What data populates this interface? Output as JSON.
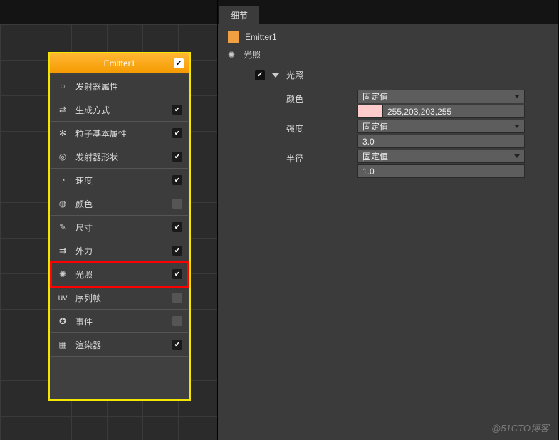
{
  "left": {
    "emitter_name": "Emitter1",
    "rows": [
      {
        "icon": "circle-outline-icon",
        "glyph": "○",
        "label": "发射器属性",
        "checked": null
      },
      {
        "icon": "shuffle-icon",
        "glyph": "⇄",
        "label": "生成方式",
        "checked": true
      },
      {
        "icon": "particle-icon",
        "glyph": "✻",
        "label": "粒子基本属性",
        "checked": true
      },
      {
        "icon": "target-icon",
        "glyph": "◎",
        "label": "发射器形状",
        "checked": true
      },
      {
        "icon": "speed-icon",
        "glyph": "◔",
        "label": "速度",
        "checked": true
      },
      {
        "icon": "palette-icon",
        "glyph": "◍",
        "label": "颜色",
        "checked": false
      },
      {
        "icon": "size-icon",
        "glyph": "✎",
        "label": "尺寸",
        "checked": true
      },
      {
        "icon": "force-icon",
        "glyph": "⇉",
        "label": "外力",
        "checked": true
      },
      {
        "icon": "light-icon",
        "glyph": "✺",
        "label": "光照",
        "checked": true
      },
      {
        "icon": "uv-icon",
        "glyph": "uv",
        "label": "序列帧",
        "checked": false
      },
      {
        "icon": "event-icon",
        "glyph": "✪",
        "label": "事件",
        "checked": false
      },
      {
        "icon": "renderer-icon",
        "glyph": "▦",
        "label": "渲染器",
        "checked": true
      }
    ],
    "highlight_index": 8
  },
  "right": {
    "tab": "细节",
    "object_name": "Emitter1",
    "subtitle": "光照",
    "section_label": "光照",
    "section_checked": true,
    "props": [
      {
        "label": "颜色",
        "dropdown": "固定值",
        "color_value": "255,203,203,255",
        "color_hex": "#ffcbcb"
      },
      {
        "label": "强度",
        "dropdown": "固定值",
        "value": "3.0"
      },
      {
        "label": "半径",
        "dropdown": "固定值",
        "value": "1.0"
      }
    ]
  },
  "watermark": "@51CTO博客"
}
